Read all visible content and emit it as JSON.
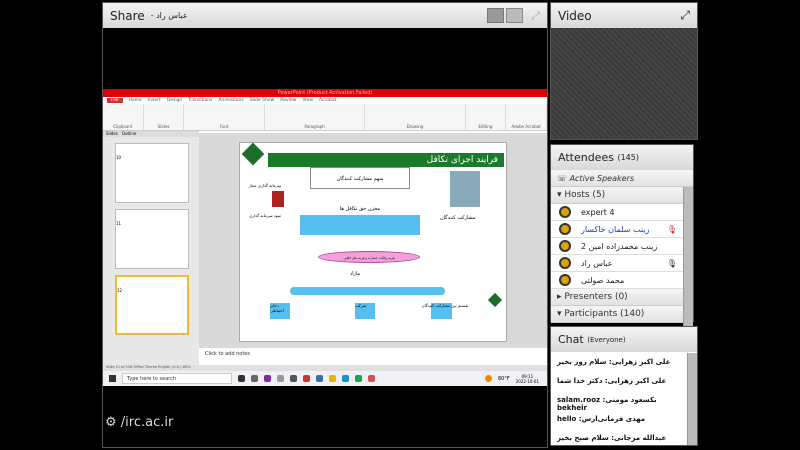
{
  "share": {
    "title": "Share",
    "presenter": "- عباس راد"
  },
  "video": {
    "title": "Video"
  },
  "screen": {
    "window_title": "PowerPoint (Product Activation Failed)",
    "menu": [
      "File",
      "Home",
      "Insert",
      "Design",
      "Transitions",
      "Animations",
      "Slide Show",
      "Review",
      "View",
      "Acrobat"
    ],
    "ribbon_groups": [
      "Clipboard",
      "Slides",
      "Font",
      "Paragraph",
      "Drawing",
      "Editing",
      "Adobe Acrobat"
    ],
    "panel_tabs": [
      "Slides",
      "Outline"
    ],
    "slide_numbers": [
      "10",
      "11",
      "12"
    ],
    "slide": {
      "title": "فرایند اجرای تکافل",
      "share": "سهم مشارکت کنندگان",
      "pool": "مخزن حق تکافل ها",
      "ellipse": "هزینه وکالت، خسارت و هزینه های اتکایی",
      "surplus": "مازاد",
      "participants": "مشارکت کنندگان",
      "investment": "سرمایه گذاری مجاز",
      "profit": "سود سرمایه گذاری",
      "buckets": [
        "ذخایر احتیاطی",
        "شرکت",
        "تقسیم بین مشارکت کنندگان"
      ]
    },
    "notes": "Click to add notes",
    "status": "Slide 11 of 126   Office Theme   English (U.S.)   60%",
    "search_placeholder": "Type here to search",
    "temp": "80°F",
    "time": "09:11",
    "date": "2022-10-01"
  },
  "watermark": "/irc.ac.ir",
  "attendees": {
    "title": "Attendees",
    "count": "(145)",
    "active": "Active Speakers",
    "hosts": "Hosts (5)",
    "host_list": [
      "expert 4",
      "زینب سلمان خاکسار",
      "زینب محمدزاده امین 2",
      "عباس راد",
      "محمد صولتی"
    ],
    "presenters": "Presenters (0)",
    "participants": "Participants (140)"
  },
  "chat": {
    "title": "Chat",
    "scope": "(Everyone)",
    "messages": [
      "علی اکبر زهرایی: سلام روز بخیر",
      "علی اکبر زهرایی: دکتر خدا شما",
      "بکسعود مومنی: salam.rooz bekheir",
      "مهدی فرمانی‌ارس: hello",
      "عبدالله مرجانی: سلام صبح بخیر"
    ]
  }
}
